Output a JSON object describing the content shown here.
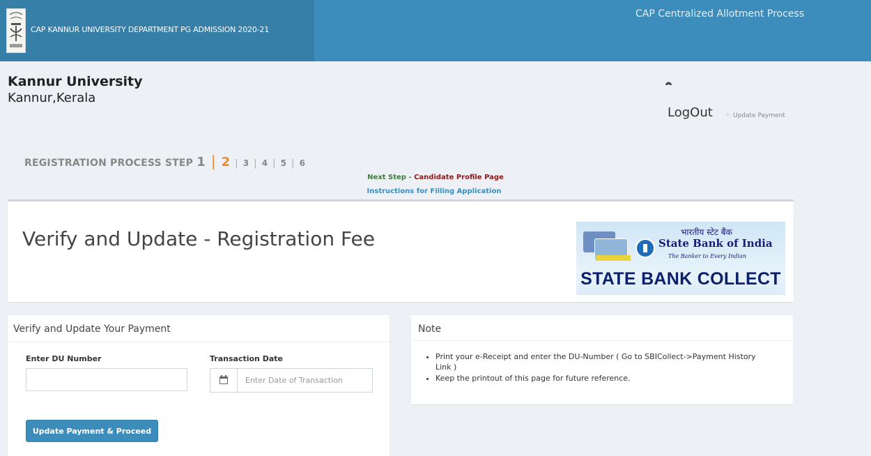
{
  "header": {
    "brand_text": "CAP KANNUR UNIVERSITY DEPARTMENT PG ADMISSION 2020-21",
    "cap_title": "CAP Centralized Allotment Process"
  },
  "org": {
    "name": "Kannur University",
    "location": "Kannur,Kerala"
  },
  "nav": {
    "gauge_icon": "dashboard-icon",
    "logout_label": "LogOut",
    "breadcrumb_sep": ">",
    "breadcrumb_current": "Update Payment"
  },
  "steps": {
    "label": "REGISTRATION PROCESS STEP",
    "items": [
      "1",
      "2",
      "3",
      "4",
      "5",
      "6"
    ],
    "current": "2"
  },
  "next_step": {
    "label": "Next Step",
    "dash": " - ",
    "target": "Candidate Profile Page"
  },
  "instructions_link": "Instructions for Filling Application",
  "page_title": "Verify and Update - Registration Fee",
  "sbi_banner": {
    "hindi": "भारतीय स्टेट बैंक",
    "name": "State Bank of India",
    "tagline": "The Banker to Every Indian",
    "collect": "STATE BANK COLLECT"
  },
  "payment_panel": {
    "title": "Verify and Update Your Payment",
    "du_label": "Enter DU Number",
    "du_value": "",
    "date_label": "Transaction Date",
    "date_placeholder": "Enter Date of Transaction",
    "date_icon": "calendar-icon",
    "submit_label": "Update Payment & Proceed"
  },
  "note_panel": {
    "title": "Note",
    "items": [
      "Print your e-Receipt and enter the DU-Number ( Go to SBICollect->Payment History Link )",
      "Keep the printout of this page for future reference."
    ]
  },
  "colors": {
    "header_bg": "#3c8dbc",
    "brand_bg": "#367fa9",
    "active_step": "#f0892a",
    "button_bg": "#3c8dbc",
    "next_step_green": "#3f7c3f",
    "next_step_red": "#8b1a1a",
    "page_bg": "#edf0f4"
  }
}
